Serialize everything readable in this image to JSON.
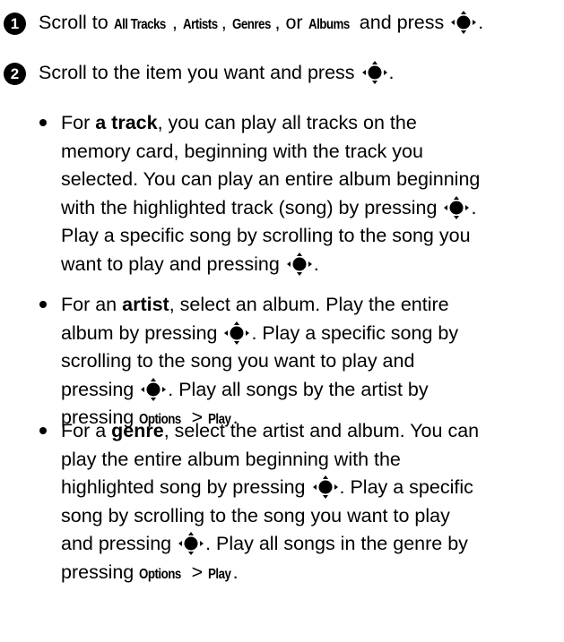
{
  "steps": [
    {
      "number": "1",
      "text_before": "Scroll to ",
      "term_all_tracks": "All Tracks",
      "sep1": ", ",
      "term_artists": "Artists",
      "sep2": ", ",
      "term_genres": "Genres",
      "sep3": ", or ",
      "term_albums": "Albums",
      "text_after": " and press "
    },
    {
      "number": "2",
      "text": "Scroll to the item you want and press "
    }
  ],
  "bullets": [
    {
      "lead_before": "For ",
      "lead_bold": "a track",
      "lines": [
        ", you can play all tracks on the",
        "memory card, beginning with the track you",
        "selected. You can play an entire album beginning",
        "with the highlighted track (song) by pressing ",
        "Play a specific song by scrolling to the song you",
        "want to play and pressing "
      ]
    },
    {
      "lead_before": "For an ",
      "lead_bold": "artist",
      "lines": [
        ", select an album. Play the entire",
        "album by pressing ",
        ". Play a specific song by",
        "scrolling to the song you want to play and",
        "pressing ",
        ". Play all songs by the artist by",
        "pressing "
      ],
      "options": "Options",
      "gt": " > ",
      "play": "Play",
      "end": "."
    },
    {
      "lead_before": "For a ",
      "lead_bold": "genre",
      "lines": [
        ", select the artist and album. You can",
        "play the entire album beginning with the",
        "highlighted song by pressing ",
        ". Play a specific",
        "song by scrolling to the song you want to play",
        "and pressing ",
        ". Play all songs in the genre by",
        "pressing "
      ],
      "options": "Options",
      "gt": " > ",
      "play": "Play",
      "end": "."
    }
  ],
  "punct": {
    "period": ".",
    "period_space": ". "
  },
  "icons": {
    "select_key": "navigation-select-key-icon",
    "step_badge": "numbered-circle-icon",
    "bullet": "bullet-dot"
  }
}
